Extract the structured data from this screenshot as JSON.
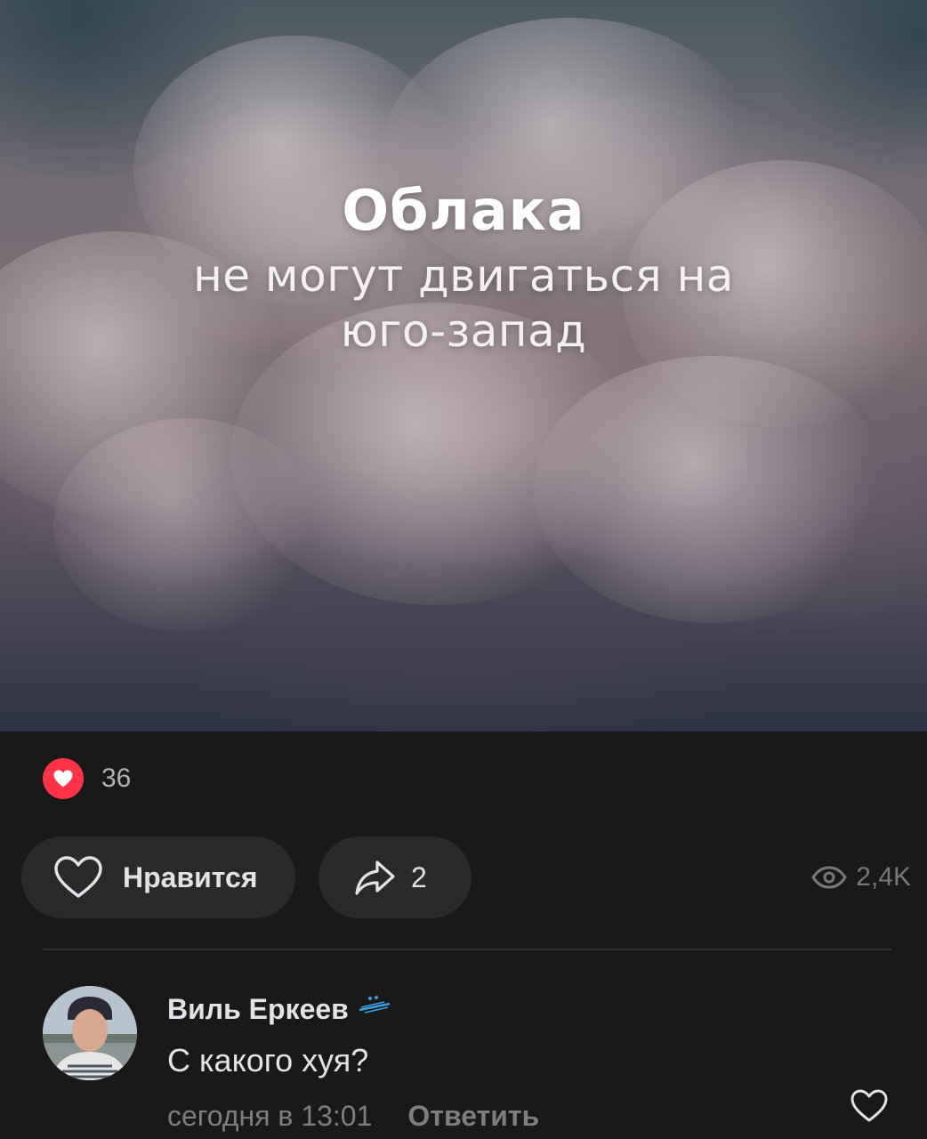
{
  "post": {
    "image": {
      "title": "Облака",
      "line1": "не могут двигаться на",
      "line2": "юго-запад"
    },
    "reactions": {
      "icon": "heart-icon",
      "count": "36",
      "color": "#ff3347"
    },
    "actions": {
      "like_label": "Нравится",
      "share_count": "2",
      "views": "2,4K"
    }
  },
  "comment": {
    "author": "Виль Еркеев",
    "badge_icon": "zenit-logo-icon",
    "text": "С какого хуя?",
    "time": "сегодня в 13:01",
    "reply_label": "Ответить"
  },
  "colors": {
    "background": "#191919",
    "pill": "#2a2a2b",
    "text_primary": "#e1e3e6",
    "text_secondary": "#7c7e82",
    "reaction_red": "#ff3347",
    "badge_blue": "#36a2e6"
  }
}
